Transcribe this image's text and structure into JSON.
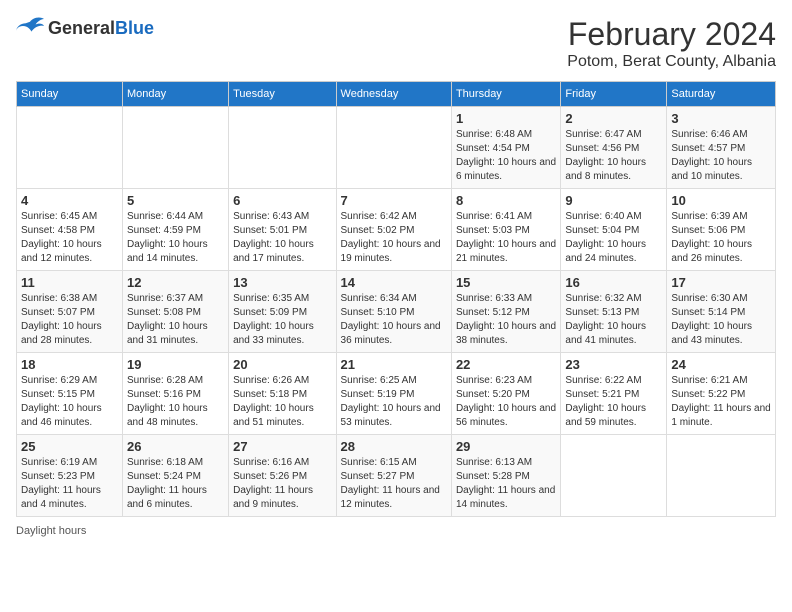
{
  "header": {
    "logo_general": "General",
    "logo_blue": "Blue",
    "title": "February 2024",
    "subtitle": "Potom, Berat County, Albania"
  },
  "days_of_week": [
    "Sunday",
    "Monday",
    "Tuesday",
    "Wednesday",
    "Thursday",
    "Friday",
    "Saturday"
  ],
  "weeks": [
    [
      {
        "day": "",
        "sunrise": "",
        "sunset": "",
        "daylight": ""
      },
      {
        "day": "",
        "sunrise": "",
        "sunset": "",
        "daylight": ""
      },
      {
        "day": "",
        "sunrise": "",
        "sunset": "",
        "daylight": ""
      },
      {
        "day": "",
        "sunrise": "",
        "sunset": "",
        "daylight": ""
      },
      {
        "day": "1",
        "sunrise": "Sunrise: 6:48 AM",
        "sunset": "Sunset: 4:54 PM",
        "daylight": "Daylight: 10 hours and 6 minutes."
      },
      {
        "day": "2",
        "sunrise": "Sunrise: 6:47 AM",
        "sunset": "Sunset: 4:56 PM",
        "daylight": "Daylight: 10 hours and 8 minutes."
      },
      {
        "day": "3",
        "sunrise": "Sunrise: 6:46 AM",
        "sunset": "Sunset: 4:57 PM",
        "daylight": "Daylight: 10 hours and 10 minutes."
      }
    ],
    [
      {
        "day": "4",
        "sunrise": "Sunrise: 6:45 AM",
        "sunset": "Sunset: 4:58 PM",
        "daylight": "Daylight: 10 hours and 12 minutes."
      },
      {
        "day": "5",
        "sunrise": "Sunrise: 6:44 AM",
        "sunset": "Sunset: 4:59 PM",
        "daylight": "Daylight: 10 hours and 14 minutes."
      },
      {
        "day": "6",
        "sunrise": "Sunrise: 6:43 AM",
        "sunset": "Sunset: 5:01 PM",
        "daylight": "Daylight: 10 hours and 17 minutes."
      },
      {
        "day": "7",
        "sunrise": "Sunrise: 6:42 AM",
        "sunset": "Sunset: 5:02 PM",
        "daylight": "Daylight: 10 hours and 19 minutes."
      },
      {
        "day": "8",
        "sunrise": "Sunrise: 6:41 AM",
        "sunset": "Sunset: 5:03 PM",
        "daylight": "Daylight: 10 hours and 21 minutes."
      },
      {
        "day": "9",
        "sunrise": "Sunrise: 6:40 AM",
        "sunset": "Sunset: 5:04 PM",
        "daylight": "Daylight: 10 hours and 24 minutes."
      },
      {
        "day": "10",
        "sunrise": "Sunrise: 6:39 AM",
        "sunset": "Sunset: 5:06 PM",
        "daylight": "Daylight: 10 hours and 26 minutes."
      }
    ],
    [
      {
        "day": "11",
        "sunrise": "Sunrise: 6:38 AM",
        "sunset": "Sunset: 5:07 PM",
        "daylight": "Daylight: 10 hours and 28 minutes."
      },
      {
        "day": "12",
        "sunrise": "Sunrise: 6:37 AM",
        "sunset": "Sunset: 5:08 PM",
        "daylight": "Daylight: 10 hours and 31 minutes."
      },
      {
        "day": "13",
        "sunrise": "Sunrise: 6:35 AM",
        "sunset": "Sunset: 5:09 PM",
        "daylight": "Daylight: 10 hours and 33 minutes."
      },
      {
        "day": "14",
        "sunrise": "Sunrise: 6:34 AM",
        "sunset": "Sunset: 5:10 PM",
        "daylight": "Daylight: 10 hours and 36 minutes."
      },
      {
        "day": "15",
        "sunrise": "Sunrise: 6:33 AM",
        "sunset": "Sunset: 5:12 PM",
        "daylight": "Daylight: 10 hours and 38 minutes."
      },
      {
        "day": "16",
        "sunrise": "Sunrise: 6:32 AM",
        "sunset": "Sunset: 5:13 PM",
        "daylight": "Daylight: 10 hours and 41 minutes."
      },
      {
        "day": "17",
        "sunrise": "Sunrise: 6:30 AM",
        "sunset": "Sunset: 5:14 PM",
        "daylight": "Daylight: 10 hours and 43 minutes."
      }
    ],
    [
      {
        "day": "18",
        "sunrise": "Sunrise: 6:29 AM",
        "sunset": "Sunset: 5:15 PM",
        "daylight": "Daylight: 10 hours and 46 minutes."
      },
      {
        "day": "19",
        "sunrise": "Sunrise: 6:28 AM",
        "sunset": "Sunset: 5:16 PM",
        "daylight": "Daylight: 10 hours and 48 minutes."
      },
      {
        "day": "20",
        "sunrise": "Sunrise: 6:26 AM",
        "sunset": "Sunset: 5:18 PM",
        "daylight": "Daylight: 10 hours and 51 minutes."
      },
      {
        "day": "21",
        "sunrise": "Sunrise: 6:25 AM",
        "sunset": "Sunset: 5:19 PM",
        "daylight": "Daylight: 10 hours and 53 minutes."
      },
      {
        "day": "22",
        "sunrise": "Sunrise: 6:23 AM",
        "sunset": "Sunset: 5:20 PM",
        "daylight": "Daylight: 10 hours and 56 minutes."
      },
      {
        "day": "23",
        "sunrise": "Sunrise: 6:22 AM",
        "sunset": "Sunset: 5:21 PM",
        "daylight": "Daylight: 10 hours and 59 minutes."
      },
      {
        "day": "24",
        "sunrise": "Sunrise: 6:21 AM",
        "sunset": "Sunset: 5:22 PM",
        "daylight": "Daylight: 11 hours and 1 minute."
      }
    ],
    [
      {
        "day": "25",
        "sunrise": "Sunrise: 6:19 AM",
        "sunset": "Sunset: 5:23 PM",
        "daylight": "Daylight: 11 hours and 4 minutes."
      },
      {
        "day": "26",
        "sunrise": "Sunrise: 6:18 AM",
        "sunset": "Sunset: 5:24 PM",
        "daylight": "Daylight: 11 hours and 6 minutes."
      },
      {
        "day": "27",
        "sunrise": "Sunrise: 6:16 AM",
        "sunset": "Sunset: 5:26 PM",
        "daylight": "Daylight: 11 hours and 9 minutes."
      },
      {
        "day": "28",
        "sunrise": "Sunrise: 6:15 AM",
        "sunset": "Sunset: 5:27 PM",
        "daylight": "Daylight: 11 hours and 12 minutes."
      },
      {
        "day": "29",
        "sunrise": "Sunrise: 6:13 AM",
        "sunset": "Sunset: 5:28 PM",
        "daylight": "Daylight: 11 hours and 14 minutes."
      },
      {
        "day": "",
        "sunrise": "",
        "sunset": "",
        "daylight": ""
      },
      {
        "day": "",
        "sunrise": "",
        "sunset": "",
        "daylight": ""
      }
    ]
  ],
  "footer": {
    "daylight_label": "Daylight hours"
  }
}
